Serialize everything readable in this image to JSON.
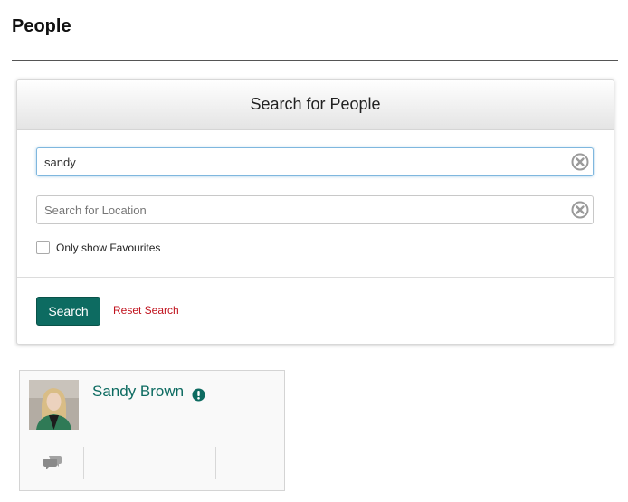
{
  "page": {
    "title": "People"
  },
  "search_panel": {
    "title": "Search for People",
    "name_input": {
      "value": "sandy",
      "placeholder": ""
    },
    "location_input": {
      "value": "",
      "placeholder": "Search for Location"
    },
    "favourites_label": "Only show Favourites",
    "favourites_checked": false,
    "search_button_label": "Search",
    "reset_label": "Reset Search"
  },
  "results": [
    {
      "name": "Sandy Brown",
      "avatar_icon": "person-photo",
      "status_icon": "alert-icon",
      "action_icon": "chat-icon"
    }
  ],
  "colors": {
    "accent": "#0d6b61",
    "reset_link": "#c0121d"
  }
}
